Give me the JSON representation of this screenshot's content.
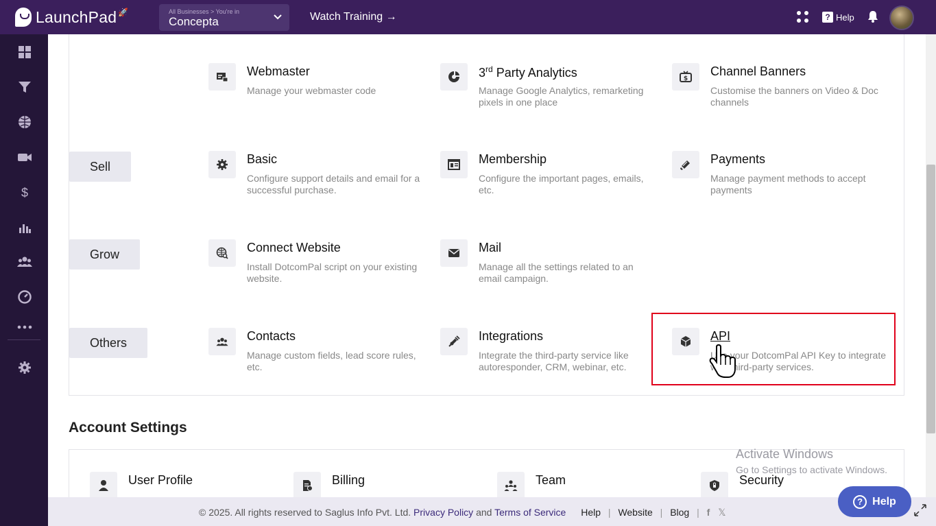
{
  "header": {
    "logo_text": "LaunchPad",
    "business_caption": "All Businesses > You're in",
    "business_name": "Concepta",
    "watch_training": "Watch Training →",
    "help_label": "Help"
  },
  "sidebar": {
    "icons": [
      "dashboard-icon",
      "funnel-icon",
      "globe-icon",
      "video-icon",
      "dollar-icon",
      "analytics-icon",
      "users-icon",
      "gauge-icon",
      "more-icon",
      "settings-icon"
    ]
  },
  "categories": {
    "sell": "Sell",
    "grow": "Grow",
    "others": "Others"
  },
  "items": {
    "webmaster": {
      "title": "Webmaster",
      "desc": "Manage your webmaster code"
    },
    "analytics": {
      "title_pre": "3",
      "title_sup": "rd",
      "title_post": " Party Analytics",
      "desc": "Manage Google Analytics, remarketing pixels in one place"
    },
    "banners": {
      "title": "Channel Banners",
      "desc": "Customise the banners on Video & Doc channels"
    },
    "basic": {
      "title": "Basic",
      "desc": "Configure support details and email for a successful purchase."
    },
    "membership": {
      "title": "Membership",
      "desc": "Configure the important pages, emails, etc."
    },
    "payments": {
      "title": "Payments",
      "desc": "Manage payment methods to accept payments"
    },
    "connect": {
      "title": "Connect Website",
      "desc": "Install DotcomPal script on your existing website."
    },
    "mail": {
      "title": "Mail",
      "desc": "Manage all the settings related to an email campaign."
    },
    "contacts": {
      "title": "Contacts",
      "desc": "Manage custom fields, lead score rules, etc."
    },
    "integrations": {
      "title": "Integrations",
      "desc": "Integrate the third-party service like autoresponder, CRM, webinar, etc."
    },
    "api": {
      "title": "API",
      "desc": "Use your DotcomPal API Key to integrate with third-party services."
    }
  },
  "account": {
    "title": "Account Settings",
    "items": [
      "User Profile",
      "Billing",
      "Team",
      "Security"
    ]
  },
  "watermark": {
    "line1": "Activate Windows",
    "line2": "Go to Settings to activate Windows."
  },
  "footer": {
    "copyright": "©  2025. All rights reserved to Saglus Info Pvt. Ltd.",
    "privacy": "Privacy Policy",
    "and": "and",
    "terms": "Terms of Service",
    "help": "Help",
    "website": "Website",
    "blog": "Blog"
  },
  "help_button": "Help"
}
